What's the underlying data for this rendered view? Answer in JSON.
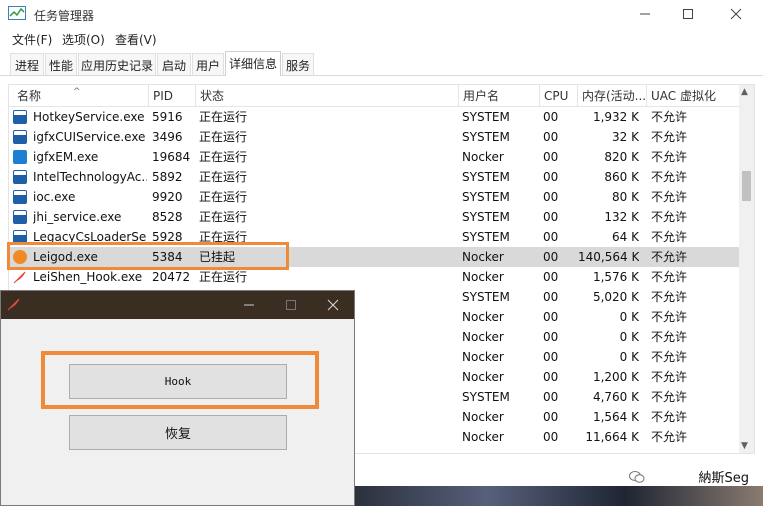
{
  "window": {
    "title": "任务管理器"
  },
  "menu": [
    "文件(F)",
    "选项(O)",
    "查看(V)"
  ],
  "tabs": [
    "进程",
    "性能",
    "应用历史记录",
    "启动",
    "用户",
    "详细信息",
    "服务"
  ],
  "active_tab": "详细信息",
  "columns": [
    "名称",
    "PID",
    "状态",
    "用户名",
    "CPU",
    "内存(活动...",
    "UAC 虚拟化"
  ],
  "processes": [
    {
      "name": "HotkeyService.exe",
      "pid": "5916",
      "status": "正在运行",
      "user": "SYSTEM",
      "cpu": "00",
      "mem": "1,932 K",
      "uac": "不允许",
      "icon": "blue-window"
    },
    {
      "name": "igfxCUIService.exe",
      "pid": "3496",
      "status": "正在运行",
      "user": "SYSTEM",
      "cpu": "00",
      "mem": "32 K",
      "uac": "不允许",
      "icon": "blue-window"
    },
    {
      "name": "igfxEM.exe",
      "pid": "19684",
      "status": "正在运行",
      "user": "Nocker",
      "cpu": "00",
      "mem": "820 K",
      "uac": "不允许",
      "icon": "intel-graphics"
    },
    {
      "name": "IntelTechnologyAc...",
      "pid": "5892",
      "status": "正在运行",
      "user": "SYSTEM",
      "cpu": "00",
      "mem": "860 K",
      "uac": "不允许",
      "icon": "blue-window"
    },
    {
      "name": "ioc.exe",
      "pid": "9920",
      "status": "正在运行",
      "user": "SYSTEM",
      "cpu": "00",
      "mem": "80 K",
      "uac": "不允许",
      "icon": "blue-window"
    },
    {
      "name": "jhi_service.exe",
      "pid": "8528",
      "status": "正在运行",
      "user": "SYSTEM",
      "cpu": "00",
      "mem": "132 K",
      "uac": "不允许",
      "icon": "blue-window"
    },
    {
      "name": "LegacyCsLoaderSe...",
      "pid": "5928",
      "status": "正在运行",
      "user": "SYSTEM",
      "cpu": "00",
      "mem": "64 K",
      "uac": "不允许",
      "icon": "blue-window"
    },
    {
      "name": "Leigod.exe",
      "pid": "5384",
      "status": "已挂起",
      "user": "Nocker",
      "cpu": "00",
      "mem": "140,564 K",
      "uac": "不允许",
      "icon": "leigod",
      "selected": true
    },
    {
      "name": "LeiShen_Hook.exe",
      "pid": "20472",
      "status": "正在运行",
      "user": "Nocker",
      "cpu": "00",
      "mem": "1,576 K",
      "uac": "不允许",
      "icon": "feather"
    },
    {
      "name": "",
      "pid": "",
      "status": "",
      "user": "SYSTEM",
      "cpu": "00",
      "mem": "5,020 K",
      "uac": "不允许",
      "icon": ""
    },
    {
      "name": "",
      "pid": "",
      "status": "",
      "user": "Nocker",
      "cpu": "00",
      "mem": "0 K",
      "uac": "不允许",
      "icon": ""
    },
    {
      "name": "",
      "pid": "",
      "status": "",
      "user": "Nocker",
      "cpu": "00",
      "mem": "0 K",
      "uac": "不允许",
      "icon": ""
    },
    {
      "name": "",
      "pid": "",
      "status": "",
      "user": "Nocker",
      "cpu": "00",
      "mem": "0 K",
      "uac": "不允许",
      "icon": ""
    },
    {
      "name": "",
      "pid": "",
      "status": "",
      "user": "Nocker",
      "cpu": "00",
      "mem": "1,200 K",
      "uac": "不允许",
      "icon": ""
    },
    {
      "name": "",
      "pid": "",
      "status": "",
      "user": "SYSTEM",
      "cpu": "00",
      "mem": "4,760 K",
      "uac": "不允许",
      "icon": ""
    },
    {
      "name": "",
      "pid": "",
      "status": "",
      "user": "Nocker",
      "cpu": "00",
      "mem": "1,564 K",
      "uac": "不允许",
      "icon": ""
    },
    {
      "name": "",
      "pid": "",
      "status": "",
      "user": "Nocker",
      "cpu": "00",
      "mem": "11,664 K",
      "uac": "不允许",
      "icon": ""
    }
  ],
  "hook_window": {
    "hook_label": "Hook",
    "restore_label": "恢复"
  },
  "watermark": "納斯Seg"
}
